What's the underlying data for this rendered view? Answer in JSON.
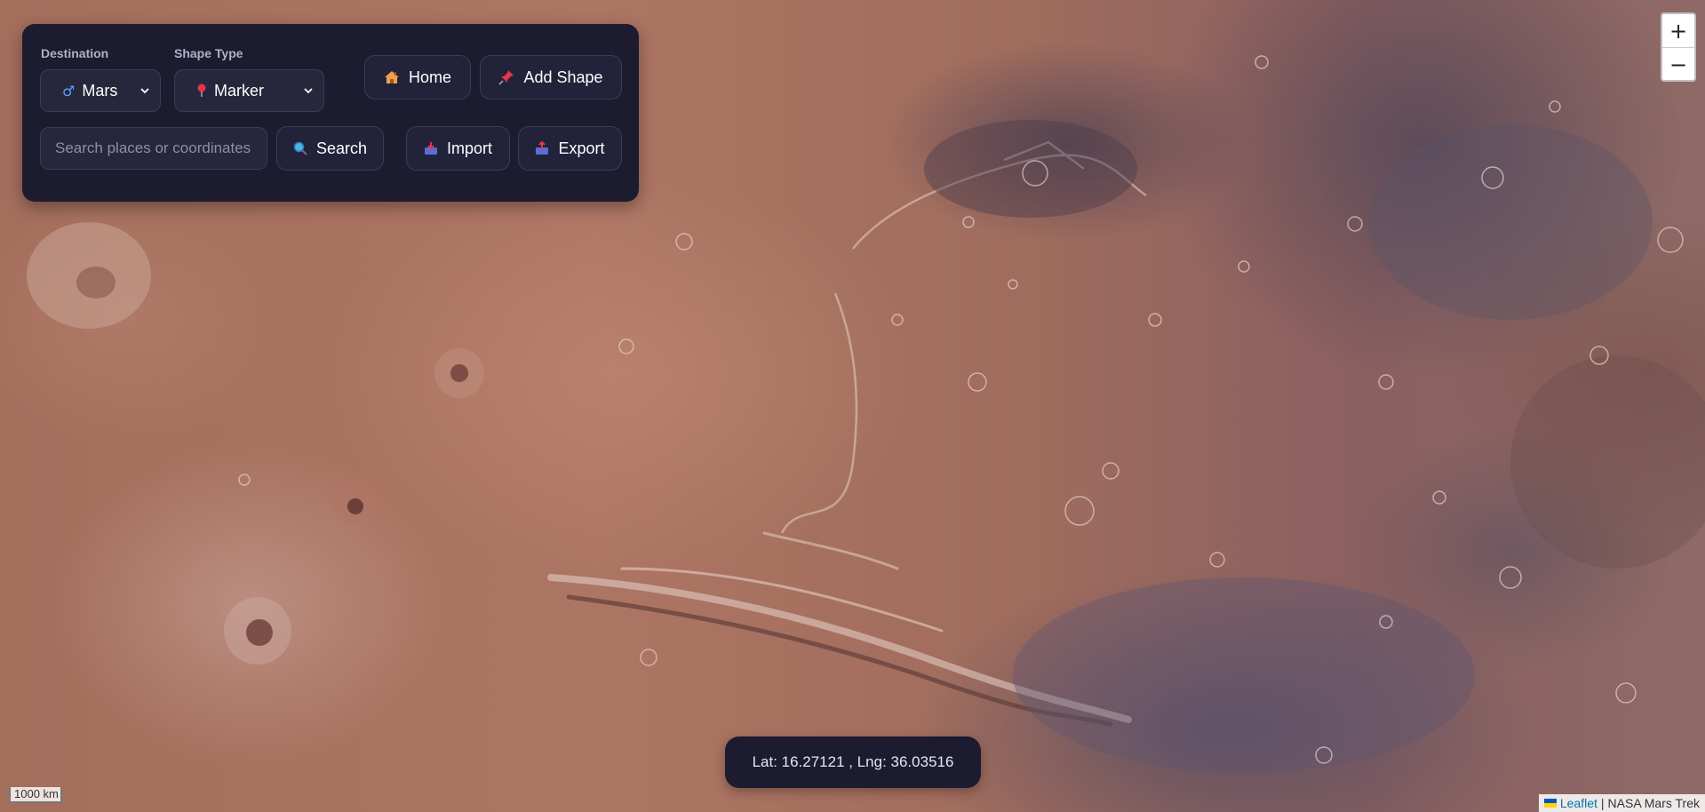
{
  "map": {
    "planet": "Mars",
    "tile_source": "NASA Mars Trek",
    "colors": {
      "panel": "#1c1b30",
      "terrain": "#a8705e",
      "dark_terrain": "#5a5268"
    }
  },
  "controls": {
    "destination_label": "Destination",
    "destination_value": "Mars",
    "destination_icon": "mars-symbol-icon",
    "shape_type_label": "Shape Type",
    "shape_type_value": "Marker",
    "shape_type_icon": "pushpin-icon",
    "home_label": "Home",
    "home_icon": "house-icon",
    "add_shape_label": "Add Shape",
    "add_shape_icon": "pin-icon",
    "search_placeholder": "Search places or coordinates",
    "search_label": "Search",
    "search_icon": "magnifier-icon",
    "import_label": "Import",
    "import_icon": "inbox-tray-icon",
    "export_label": "Export",
    "export_icon": "outbox-tray-icon"
  },
  "zoom": {
    "in_label": "+",
    "out_label": "−"
  },
  "coordinates": {
    "text": "Lat: 16.27121 , Lng: 36.03516"
  },
  "scale": {
    "label": "1000 km"
  },
  "attribution": {
    "leaflet": "Leaflet",
    "separator": "|",
    "source": "NASA Mars Trek"
  }
}
